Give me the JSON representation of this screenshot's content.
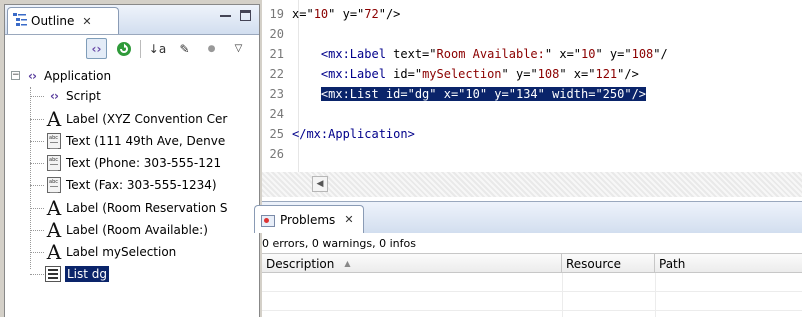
{
  "outline": {
    "tab_title": "Outline",
    "tab_close": "✕",
    "toolbar": [
      {
        "name": "show-tags-button",
        "glyph": "‹›"
      },
      {
        "name": "refresh-button",
        "glyph": "↻"
      },
      {
        "name": "sort-alpha-button",
        "glyph": "↓a"
      },
      {
        "name": "filter-button",
        "glyph": "✎"
      },
      {
        "name": "dot-button",
        "glyph": "●"
      },
      {
        "name": "view-menu-button",
        "glyph": "▽"
      }
    ],
    "tree": {
      "expander": "−",
      "root": {
        "label": "Application",
        "icon": "tags-icon"
      },
      "children": [
        {
          "label": "Script",
          "icon": "tags-icon"
        },
        {
          "label": "Label (XYZ Convention Cer",
          "icon": "label-A-icon"
        },
        {
          "label": "Text (111 49th Ave, Denve",
          "icon": "text-field-icon"
        },
        {
          "label": "Text (Phone: 303-555-121",
          "icon": "text-field-icon"
        },
        {
          "label": "Text (Fax: 303-555-1234)",
          "icon": "text-field-icon"
        },
        {
          "label": "Label (Room Reservation S",
          "icon": "label-A-icon"
        },
        {
          "label": "Label (Room Available:)",
          "icon": "label-A-icon"
        },
        {
          "label": "Label mySelection",
          "icon": "label-A-icon"
        },
        {
          "label": "List dg",
          "icon": "list-icon",
          "selected": true
        }
      ]
    }
  },
  "editor": {
    "lines": [
      {
        "num": "19",
        "parts": [
          [
            "code",
            "x=\""
          ],
          [
            "val",
            "10"
          ],
          [
            "code",
            "\" y=\""
          ],
          [
            "val",
            "72"
          ],
          [
            "code",
            "\"/>"
          ]
        ]
      },
      {
        "num": "20",
        "parts": []
      },
      {
        "num": "21",
        "parts": [
          [
            "code",
            "    "
          ],
          [
            "tag",
            "<mx:Label"
          ],
          [
            "code",
            " text=\""
          ],
          [
            "val",
            "Room Available:"
          ],
          [
            "code",
            "\" x=\""
          ],
          [
            "val",
            "10"
          ],
          [
            "code",
            "\" y=\""
          ],
          [
            "val",
            "108"
          ],
          [
            "code",
            "\"/"
          ]
        ]
      },
      {
        "num": "22",
        "parts": [
          [
            "code",
            "    "
          ],
          [
            "tag",
            "<mx:Label"
          ],
          [
            "code",
            " id=\""
          ],
          [
            "val",
            "mySelection"
          ],
          [
            "code",
            "\" y=\""
          ],
          [
            "val",
            "108"
          ],
          [
            "code",
            "\" x=\""
          ],
          [
            "val",
            "121"
          ],
          [
            "code",
            "\"/>"
          ]
        ]
      },
      {
        "num": "23",
        "parts": [
          [
            "code",
            "    "
          ],
          [
            "hl",
            "<mx:List id=\"dg\" x=\"10\" y=\"134\" width=\"250\"/>"
          ]
        ]
      },
      {
        "num": "24",
        "parts": []
      },
      {
        "num": "25",
        "parts": [
          [
            "tag",
            "</mx:Application>"
          ]
        ]
      },
      {
        "num": "26",
        "parts": []
      }
    ],
    "scroll_left_glyph": "◀"
  },
  "problems": {
    "tab_title": "Problems",
    "tab_close": "✕",
    "status": "0 errors, 0 warnings, 0 infos",
    "columns": [
      "Description",
      "Resource",
      "Path"
    ],
    "sort_glyph": "▲"
  }
}
